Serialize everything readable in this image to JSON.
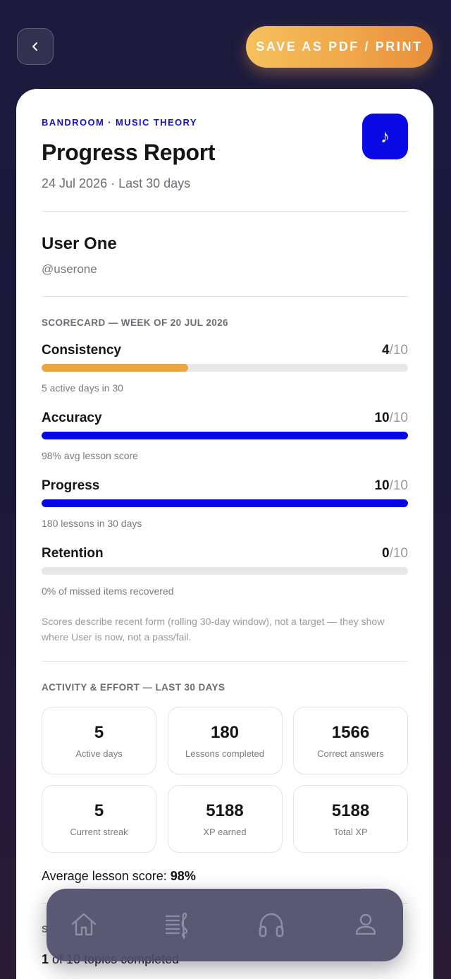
{
  "header": {
    "pdf_button_label": "SAVE AS PDF / PRINT"
  },
  "report": {
    "brand": "BANDROOM · MUSIC THEORY",
    "title": "Progress Report",
    "date_line": "24 Jul 2026 · Last 30 days",
    "logo_glyph": "♪"
  },
  "user": {
    "name": "User One",
    "handle": "@userone"
  },
  "scorecard": {
    "heading": "SCORECARD — WEEK OF 20 JUL 2026",
    "max_label": "/10",
    "metrics": [
      {
        "name": "Consistency",
        "score": "4",
        "fraction": 0.4,
        "color": "#eca543",
        "note": "5 active days in 30"
      },
      {
        "name": "Accuracy",
        "score": "10",
        "fraction": 1.0,
        "color": "#0707df",
        "note": "98% avg lesson score"
      },
      {
        "name": "Progress",
        "score": "10",
        "fraction": 1.0,
        "color": "#0707df",
        "note": "180 lessons in 30 days"
      },
      {
        "name": "Retention",
        "score": "0",
        "fraction": 0.0,
        "color": "#0707df",
        "note": "0% of missed items recovered"
      }
    ],
    "disclaimer": "Scores describe recent form (rolling 30-day window), not a target — they show where User is now, not a pass/fail."
  },
  "activity": {
    "heading": "ACTIVITY & EFFORT — LAST 30 DAYS",
    "stats": [
      {
        "value": "5",
        "label": "Active days"
      },
      {
        "value": "180",
        "label": "Lessons completed"
      },
      {
        "value": "1566",
        "label": "Correct answers"
      },
      {
        "value": "5",
        "label": "Current streak"
      },
      {
        "value": "5188",
        "label": "XP earned"
      },
      {
        "value": "5188",
        "label": "Total XP"
      }
    ],
    "avg_label": "Average lesson score:",
    "avg_value": "98%"
  },
  "topics": {
    "heading_partial": "S",
    "completed_count": "1",
    "completed_text": "of 10 topics completed"
  },
  "nav": {
    "items": [
      "home-icon",
      "sheet-music-icon",
      "headphones-icon",
      "profile-icon"
    ],
    "icon_color": "#8e8ca6"
  }
}
